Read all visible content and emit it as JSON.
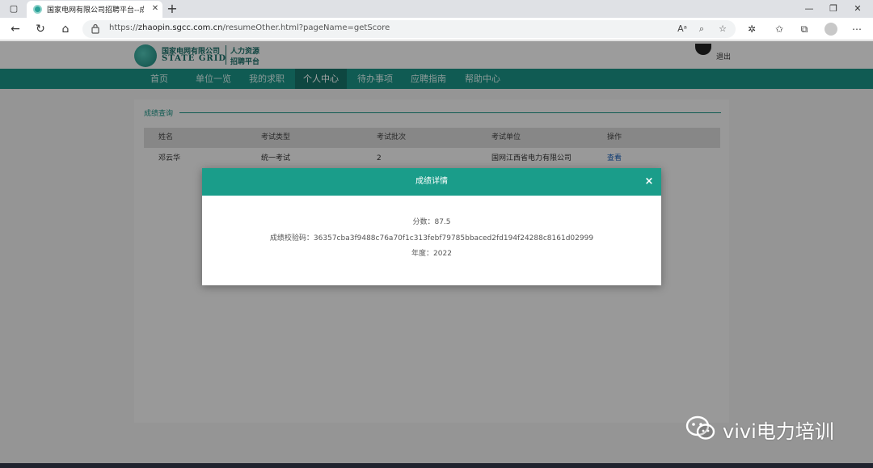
{
  "browser": {
    "tab_title": "国家电网有限公司招聘平台--成绩",
    "url_prefix": "https://",
    "url_host": "zhaopin.sgcc.com.cn",
    "url_path": "/resumeOther.html?pageName=getScore"
  },
  "header": {
    "logo_cn": "国家电网有限公司",
    "logo_en": "STATE GRID",
    "logo_sub1": "人力资源",
    "logo_sub2": "招聘平台",
    "logout": "退出"
  },
  "nav": [
    "首页",
    "单位一览",
    "我的求职",
    "个人中心",
    "待办事项",
    "应聘指南",
    "帮助中心"
  ],
  "section": {
    "legend": "成绩查询"
  },
  "table": {
    "headers": [
      "姓名",
      "考试类型",
      "考试批次",
      "考试单位",
      "操作"
    ],
    "row": [
      "邓云华",
      "统一考试",
      "2",
      "国网江西省电力有限公司",
      "查看"
    ]
  },
  "modal": {
    "title": "成绩详情",
    "close": "×",
    "score": "分数：87.5",
    "code": "成绩校验码：36357cba3f9488c76a70f1c313febf79785bbaced2fd194f24288c8161d02999",
    "year": "年度：2022"
  },
  "watermark": {
    "text": "vivi电力培训"
  },
  "colors": {
    "brand": "#1a8f82",
    "modal_header": "#1a9d8a",
    "link": "#1a5fb4"
  }
}
